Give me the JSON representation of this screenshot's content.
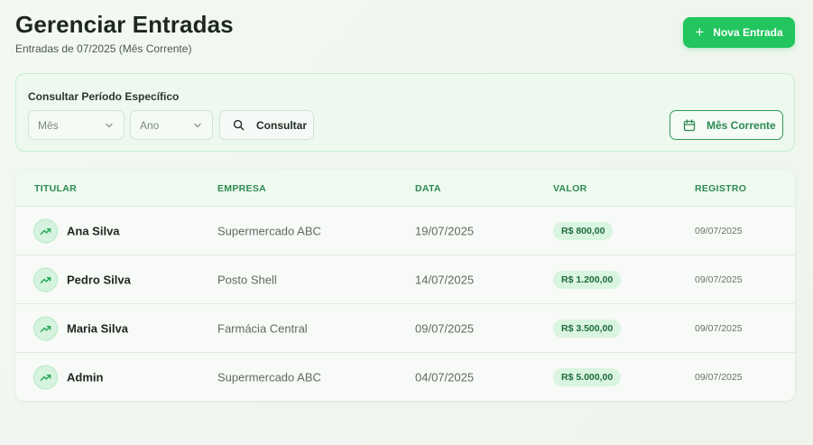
{
  "header": {
    "title": "Gerenciar Entradas",
    "subtitle": "Entradas de 07/2025 (Mês Corrente)",
    "new_button_icon": "plus-icon",
    "new_button_label": "Nova Entrada"
  },
  "filter": {
    "label": "Consultar Período Específico",
    "month_select": {
      "value": "Mês"
    },
    "year_select": {
      "value": "Ano"
    },
    "consultar_icon": "search-icon",
    "consultar_label": "Consultar",
    "current_month_icon": "calendar-icon",
    "current_month_label": "Mês Corrente"
  },
  "table": {
    "headers": [
      "TITULAR",
      "EMPRESA",
      "DATA",
      "VALOR",
      "REGISTRO"
    ],
    "row_icon": "trending-up-icon",
    "rows": [
      {
        "titular": "Ana Silva",
        "empresa": "Supermercado ABC",
        "data": "19/07/2025",
        "valor": "R$ 800,00",
        "registro": "09/07/2025"
      },
      {
        "titular": "Pedro Silva",
        "empresa": "Posto Shell",
        "data": "14/07/2025",
        "valor": "R$ 1.200,00",
        "registro": "09/07/2025"
      },
      {
        "titular": "Maria Silva",
        "empresa": "Farmácia Central",
        "data": "09/07/2025",
        "valor": "R$ 3.500,00",
        "registro": "09/07/2025"
      },
      {
        "titular": "Admin",
        "empresa": "Supermercado ABC",
        "data": "04/07/2025",
        "valor": "R$ 5.000,00",
        "registro": "09/07/2025"
      }
    ]
  },
  "colors": {
    "accent": "#22c55e",
    "accent_dark": "#2b8a50",
    "header_text": "#2f8a52",
    "badge_bg": "#d9f4e0"
  }
}
